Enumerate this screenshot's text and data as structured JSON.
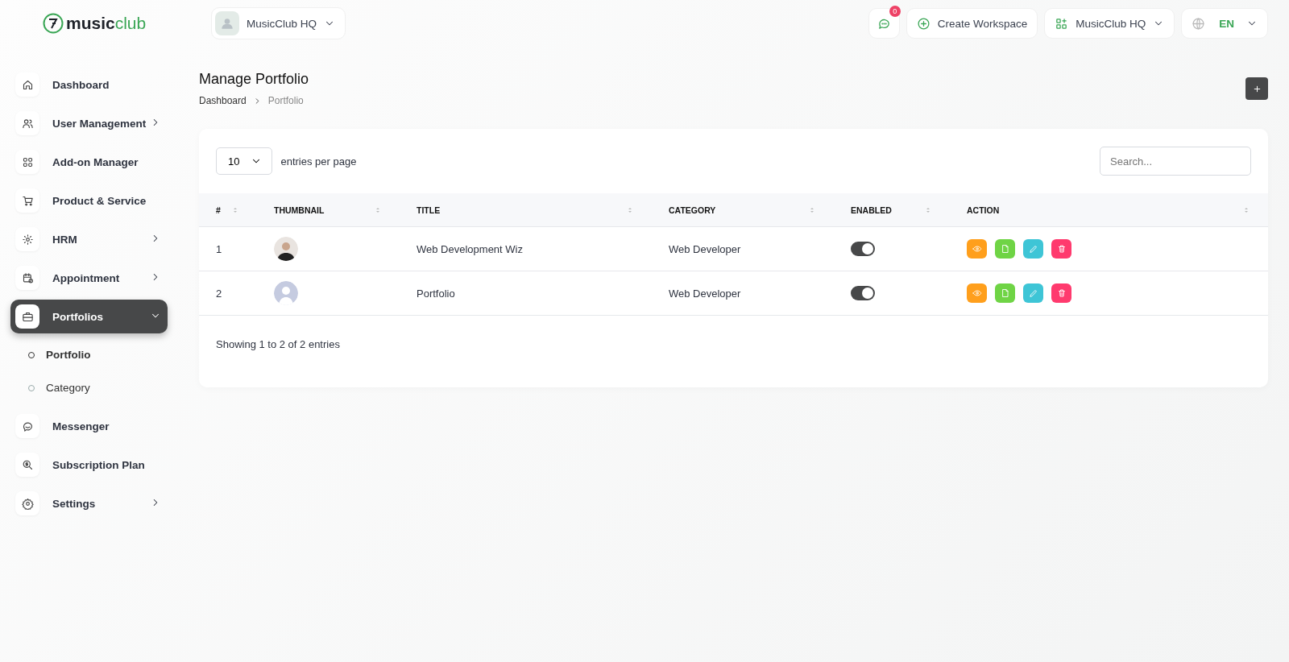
{
  "logo": {
    "text": "**music**club"
  },
  "topbar": {
    "workspace": "MusicClub HQ",
    "notifications": "0",
    "create_button": "Create Workspace",
    "workspace_menu": "MusicClub HQ",
    "language": "EN"
  },
  "sidebar": {
    "items": [
      {
        "label": "Dashboard",
        "selected": false
      },
      {
        "label": "User Management",
        "selected": false,
        "expanded": false
      },
      {
        "label": "Add-on Manager",
        "selected": false
      },
      {
        "label": "Product & Service",
        "selected": false
      },
      {
        "label": "HRM",
        "selected": false,
        "expanded": false
      },
      {
        "label": "Appointment",
        "selected": false,
        "expanded": false
      },
      {
        "label": "Portfolios",
        "selected": true,
        "expanded": true,
        "children": [
          {
            "label": "Portfolio",
            "selected": true
          },
          {
            "label": "Category",
            "selected": false
          }
        ]
      },
      {
        "label": "Messenger",
        "selected": false
      },
      {
        "label": "Subscription Plan",
        "selected": false
      },
      {
        "label": "Settings",
        "selected": false,
        "expanded": false
      }
    ]
  },
  "page": {
    "title": "Manage Portfolio",
    "breadcrumb": [
      "Dashboard",
      "Portfolio"
    ]
  },
  "table": {
    "page_size": "10",
    "page_size_label": "entries per page",
    "search_placeholder": "Search...",
    "columns": [
      "#",
      "THUMBNAIL",
      "TITLE",
      "CATEGORY",
      "ENABLED",
      "ACTION"
    ],
    "rows": [
      {
        "number": "1",
        "kind": "photo",
        "title": "Web Development Wiz",
        "category": "Web Developer",
        "enabled": true
      },
      {
        "number": "2",
        "kind": "avatar",
        "title": "Portfolio",
        "category": "Web Developer",
        "enabled": true
      }
    ],
    "footer": "Showing 1 to 2 of 2 entries"
  }
}
